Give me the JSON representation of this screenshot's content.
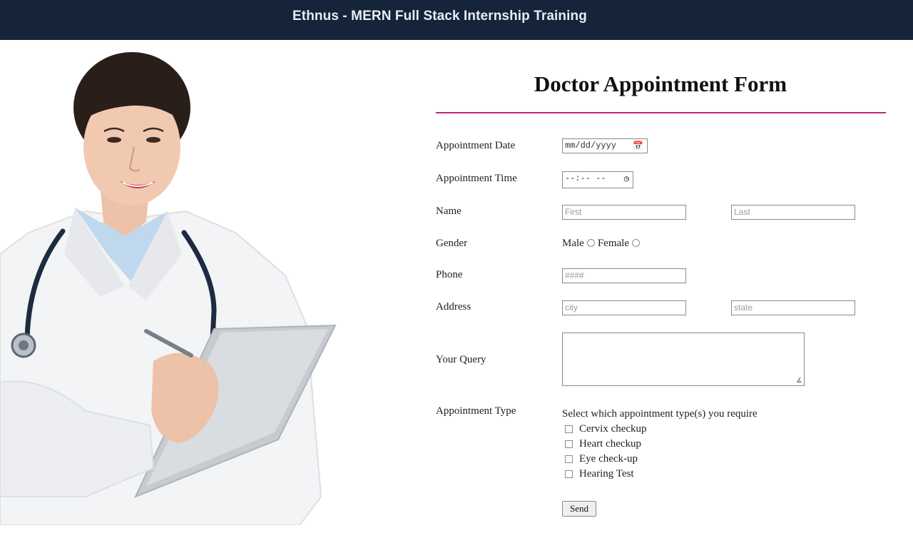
{
  "header": {
    "title": "Ethnus - MERN Full Stack Internship Training"
  },
  "form": {
    "title": "Doctor Appointment Form",
    "accent_color": "#c0287a",
    "labels": {
      "date": "Appointment Date",
      "time": "Appointment Time",
      "name": "Name",
      "gender": "Gender",
      "phone": "Phone",
      "address": "Address",
      "query": "Your Query",
      "appt_type": "Appointment Type"
    },
    "date_placeholder": "mm/dd/yyyy",
    "time_placeholder": "--:-- --",
    "first_placeholder": "First",
    "last_placeholder": "Last",
    "phone_placeholder": "####",
    "city_placeholder": "city",
    "state_placeholder": "state",
    "gender_options": [
      "Male",
      "Female"
    ],
    "appt_type_intro": "Select which appointment type(s) you require",
    "appt_types": [
      "Cervix checkup",
      "Heart checkup",
      "Eye check-up",
      "Hearing Test"
    ],
    "send_label": "Send"
  }
}
